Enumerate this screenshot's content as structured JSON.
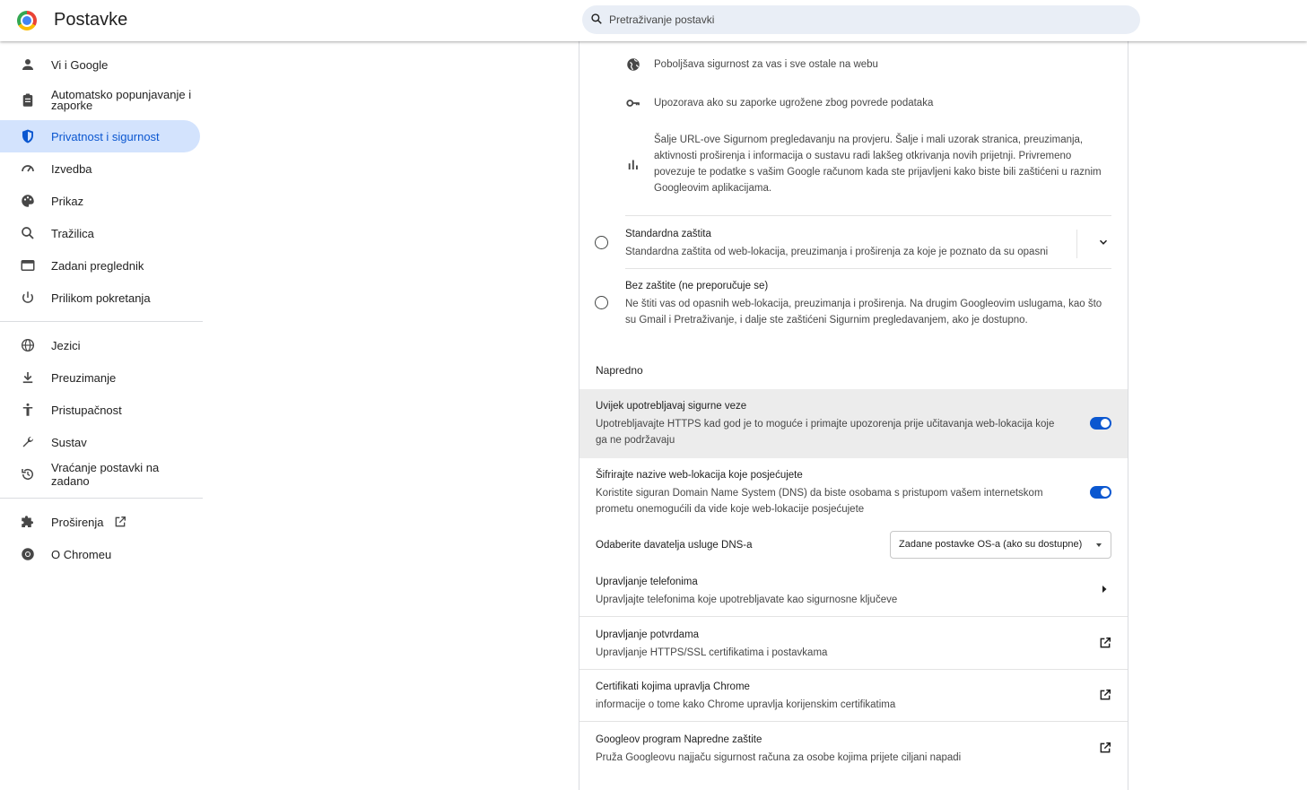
{
  "header": {
    "title": "Postavke",
    "search_placeholder": "Pretraživanje postavki"
  },
  "sidebar": {
    "items": [
      {
        "label": "Vi i Google",
        "icon": "person-icon"
      },
      {
        "label": "Automatsko popunjavanje i zaporke",
        "icon": "clipboard-icon"
      },
      {
        "label": "Privatnost i sigurnost",
        "icon": "shield-icon",
        "active": true
      },
      {
        "label": "Izvedba",
        "icon": "speedometer-icon"
      },
      {
        "label": "Prikaz",
        "icon": "palette-icon"
      },
      {
        "label": "Tražilica",
        "icon": "search-icon"
      },
      {
        "label": "Zadani preglednik",
        "icon": "browser-icon"
      },
      {
        "label": "Prilikom pokretanja",
        "icon": "power-icon"
      }
    ],
    "items2": [
      {
        "label": "Jezici",
        "icon": "globe-icon"
      },
      {
        "label": "Preuzimanje",
        "icon": "download-icon"
      },
      {
        "label": "Pristupačnost",
        "icon": "accessibility-icon"
      },
      {
        "label": "Sustav",
        "icon": "wrench-icon"
      },
      {
        "label": "Vraćanje postavki na zadano",
        "icon": "restore-icon"
      }
    ],
    "items3": [
      {
        "label": "Proširenja",
        "icon": "puzzle-icon"
      },
      {
        "label": "O Chromeu",
        "icon": "chrome-icon"
      }
    ]
  },
  "enhanced_features": [
    "Poboljšava sigurnost za vas i sve ostale na webu",
    "Upozorava ako su zaporke ugrožene zbog povrede podataka",
    "Šalje URL-ove Sigurnom pregledavanju na provjeru. Šalje i mali uzorak stranica, preuzimanja, aktivnosti proširenja i informacija o sustavu radi lakšeg otkrivanja novih prijetnji. Privremeno povezuje te podatke s vašim Google računom kada ste prijavljeni kako biste bili zaštićeni u raznim Googleovim aplikacijama."
  ],
  "standard": {
    "title": "Standardna zaštita",
    "desc": "Standardna zaštita od web-lokacija, preuzimanja i proširenja za koje je poznato da su opasni"
  },
  "no_protection": {
    "title": "Bez zaštite (ne preporučuje se)",
    "desc": "Ne štiti vas od opasnih web-lokacija, preuzimanja i proširenja. Na drugim Googleovim uslugama, kao što su Gmail i Pretraživanje, i dalje ste zaštićeni Sigurnim pregledavanjem, ako je dostupno."
  },
  "advanced_title": "Napredno",
  "https": {
    "title": "Uvijek upotrebljavaj sigurne veze",
    "desc": "Upotrebljavajte HTTPS kad god je to moguće i primajte upozorenja prije učitavanja web-lokacija koje ga ne podržavaju",
    "enabled": true
  },
  "dns": {
    "title": "Šifrirajte nazive web-lokacija koje posjećujete",
    "desc": "Koristite siguran Domain Name System (DNS) da biste osobama s pristupom vašem internetskom prometu onemogućili da vide koje web-lokacije posjećujete",
    "enabled": true,
    "provider_label": "Odaberite davatelja usluge DNS-a",
    "provider_value": "Zadane postavke OS-a (ako su dostupne)"
  },
  "phones": {
    "title": "Upravljanje telefonima",
    "desc": "Upravljajte telefonima koje upotrebljavate kao sigurnosne ključeve"
  },
  "certs": {
    "title": "Upravljanje potvrdama",
    "desc": "Upravljanje HTTPS/SSL certifikatima i postavkama"
  },
  "chrome_certs": {
    "title": "Certifikati kojima upravlja Chrome",
    "desc": "informacije o tome kako Chrome upravlja korijenskim certifikatima"
  },
  "advanced_protection": {
    "title": "Googleov program Napredne zaštite",
    "desc": "Pruža Googleovu najjaču sigurnost računa za osobe kojima prijete ciljani napadi"
  },
  "colors": {
    "accent": "#0b57d0",
    "active_bg": "#d3e3fd"
  }
}
